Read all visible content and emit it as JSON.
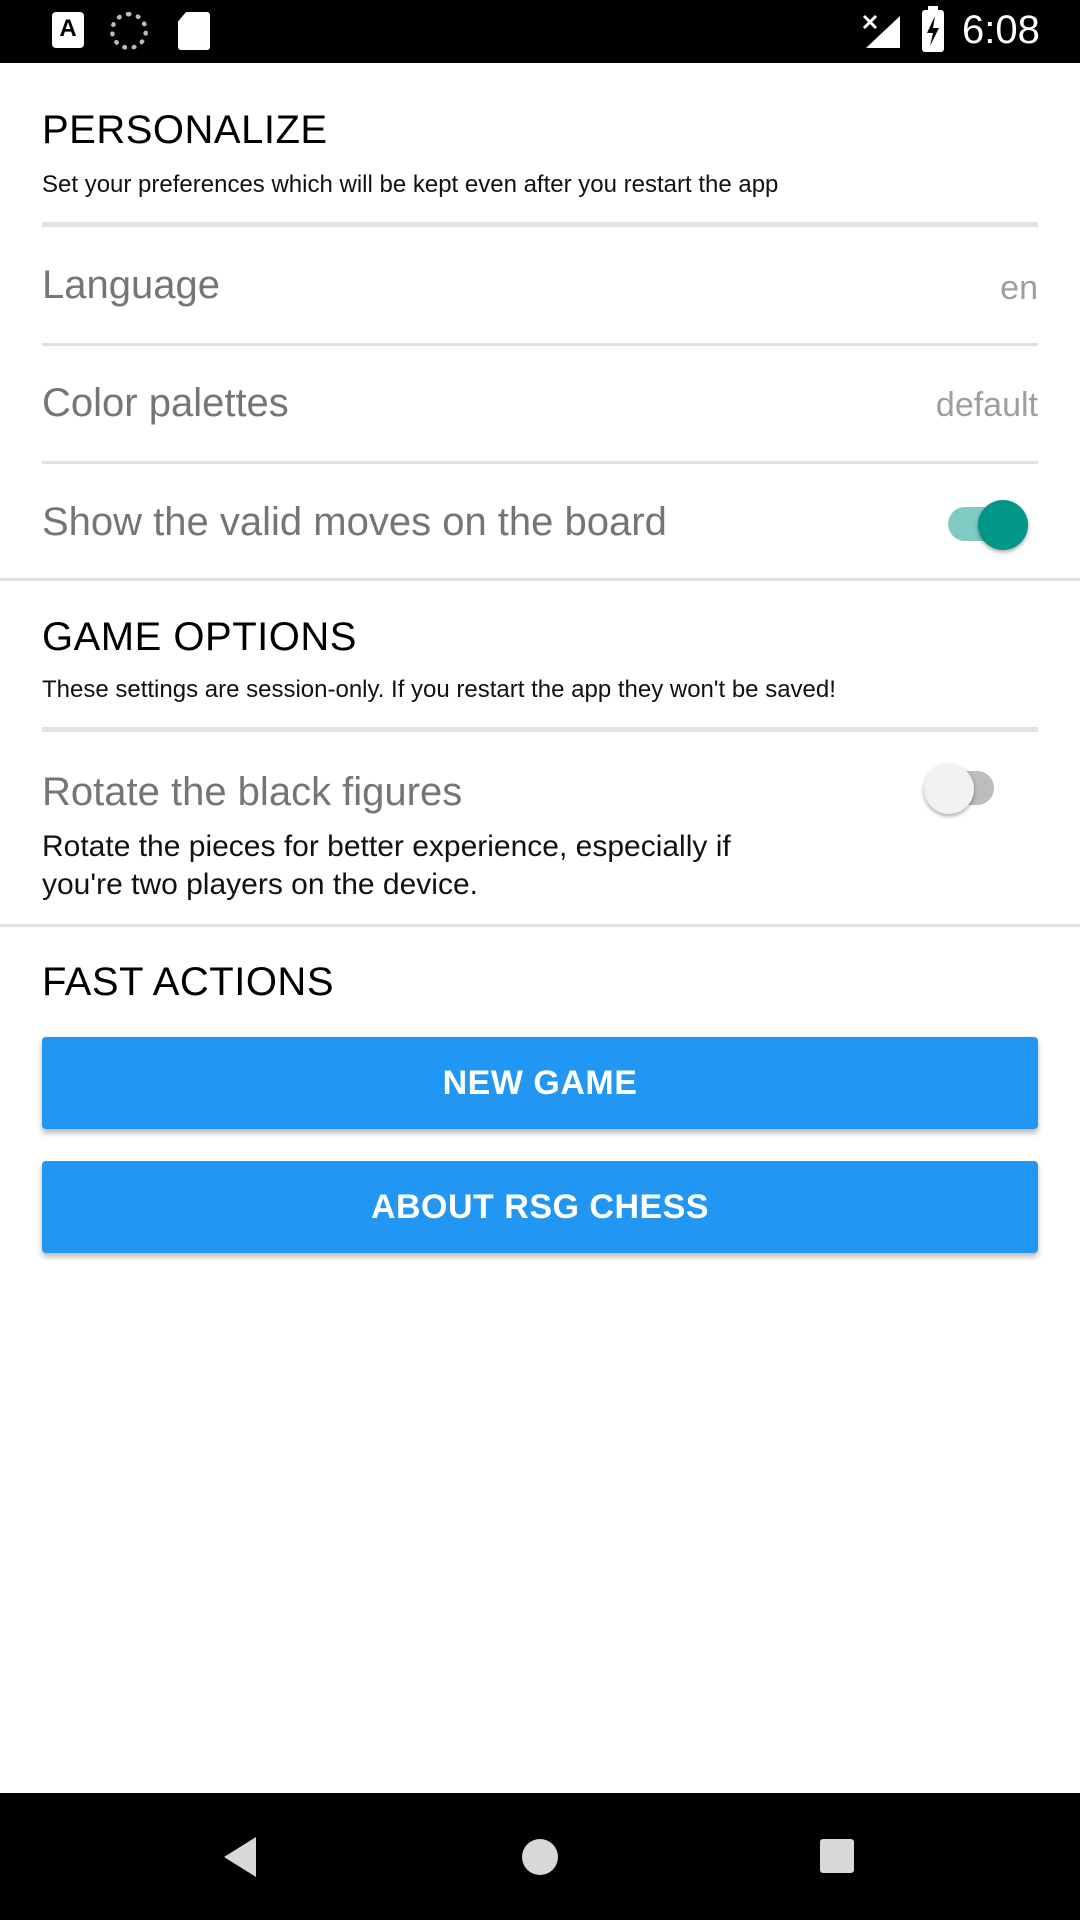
{
  "status_bar": {
    "time": "6:08",
    "icons": [
      "text-a-icon",
      "sync-icon",
      "sd-card-icon",
      "no-signal-icon",
      "battery-charging-icon"
    ]
  },
  "personalize": {
    "title": "PERSONALIZE",
    "subtitle": "Set your preferences which will be kept even after you restart the app",
    "language_label": "Language",
    "language_value": "en",
    "palette_label": "Color palettes",
    "palette_value": "default",
    "valid_moves_label": "Show the valid moves on the board",
    "valid_moves_on": true
  },
  "game_options": {
    "title": "GAME OPTIONS",
    "subtitle": "These settings are session-only. If you restart the app they won't be saved!",
    "rotate_label": "Rotate the black figures",
    "rotate_desc": "Rotate the pieces for better experience, especially if you're two players on the device.",
    "rotate_on": false
  },
  "fast_actions": {
    "title": "FAST ACTIONS",
    "new_game": "NEW GAME",
    "about": "ABOUT RSG CHESS"
  },
  "colors": {
    "accent": "#009688",
    "button": "#2196f3"
  }
}
